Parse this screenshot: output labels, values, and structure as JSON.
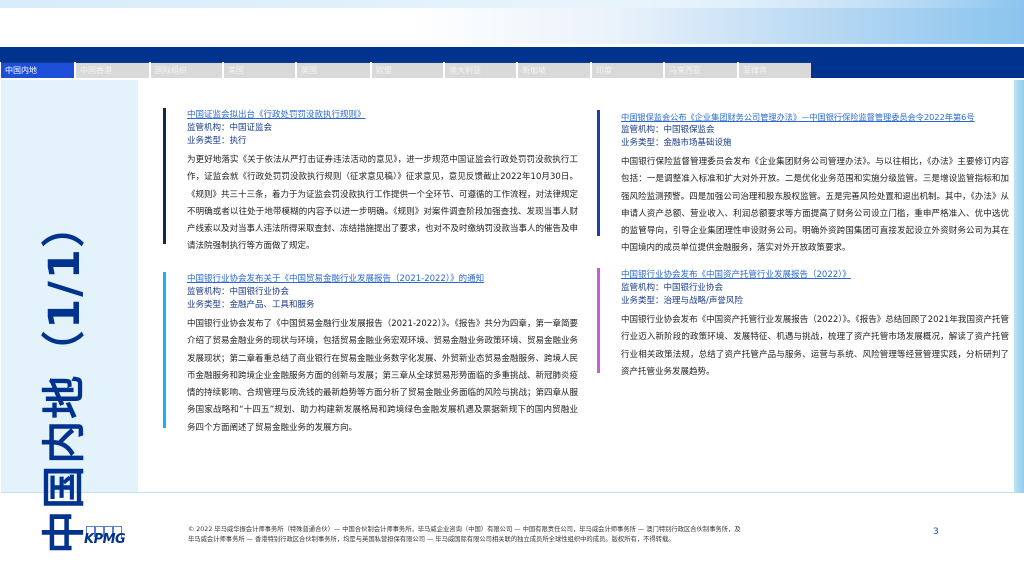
{
  "tabs": [
    {
      "label": "中国内地",
      "active": true
    },
    {
      "label": "中国香港"
    },
    {
      "label": "国际组织"
    },
    {
      "label": "美国"
    },
    {
      "label": "英国"
    },
    {
      "label": "欧盟"
    },
    {
      "label": "澳大利亚"
    },
    {
      "label": "新加坡"
    },
    {
      "label": "印度"
    },
    {
      "label": "马来西亚"
    },
    {
      "label": "菲律宾"
    }
  ],
  "section_title": "中国内地（1/1）",
  "cards": [
    {
      "title": "中国证监会拟出台《行政处罚罚没款执行规则》",
      "regulator": "监管机构：中国证监会",
      "type": "业务类型：执行",
      "body": "为更好地落实《关于依法从严打击证券违法活动的意见》，进一步规范中国证监会行政处罚罚没款执行工作，证监会就《行政处罚罚没款执行规则（征求意见稿）》征求意见，意见反馈截止2022年10月30日。《规则》共三十三条，着力于为证监会罚没款执行工作提供一个全环节、可遵循的工作流程，对法律规定不明确或者以往处于地带模糊的内容予以进一步明确。《规则》对案件调查阶段加强查找、发现当事人财产线索以及对当事人违法所得采取查封、冻结措施提出了要求，也对不及时缴纳罚没款当事人的催告及申请法院强制执行等方面做了规定。",
      "color": "#14284b"
    },
    {
      "title": "中国银行业协会发布关于《中国贸易金融行业发展报告（2021-2022）》的通知",
      "regulator": "监管机构：中国银行业协会",
      "type": "业务类型：金融产品、工具和服务",
      "body": "中国银行业协会发布了《中国贸易金融行业发展报告（2021-2022）》。《报告》共分为四章，第一章简要介绍了贸易金融业务的现状与环境，包括贸易金融业务宏观环境、贸易金融业务政策环境、贸易金融业务发展现状；第二章着重总结了商业银行在贸易金融业务数字化发展、外贸新业态贸易金融服务、跨境人民币金融服务和跨境企业金融服务方面的创新与发展；第三章从全球贸易形势面临的多重挑战、新冠肺炎疫情的持续影响、合规管理与反洗钱的最新趋势等方面分析了贸易金融业务面临的风险与挑战；第四章从服务国家战略和“十四五”规划、助力构建新发展格局和跨境绿色金融发展机遇及票据新规下的国内贸融业务四个方面阐述了贸易金融业务的发展方向。",
      "color": "#19b2ea"
    },
    {
      "title": "中国银保监会公布《企业集团财务公司管理办法》—中国银行保险监督管理委员会令2022年第6号",
      "regulator": "监管机构：中国银保监会",
      "type": "业务类型：金融市场基础设施",
      "body": "中国银行保险监督管理委员会发布《企业集团财务公司管理办法》。与以往相比，《办法》主要修订内容包括：一是调整准入标准和扩大对外开放。二是优化业务范围和实施分级监管。三是增设监管指标和加强风险监测预警。四是加强公司治理和股东股权监管。五是完善风险处置和退出机制。其中，《办法》从申请人资产总额、营业收入、利润总额要求等方面提高了财务公司设立门槛，重申严格准入、优中选优的监管导向，引导企业集团理性申设财务公司。明确外资跨国集团可直接发起设立外资财务公司为其在中国境内的成员单位提供金融服务，落实对外开放政策要求。",
      "color": "#1e3fa6"
    },
    {
      "title": "中国银行业协会发布《中国资产托管行业发展报告（2022）》",
      "regulator": "监管机构：中国银行业协会",
      "type": "业务类型：治理与战略/声誉风险",
      "body": "中国银行业协会发布《中国资产托管行业发展报告（2022）》。《报告》总结回顾了2021年我国资产托管行业迈入新阶段的政策环境、发展特征、机遇与挑战，梳理了资产托管市场发展概况，解读了资产托管行业相关政策法规，总结了资产托管产品与服务、运营与系统、风险管理等经营管理实践，分析研判了资产托管业务发展趋势。",
      "color": "#c25fd1"
    }
  ],
  "footer": {
    "logo": "KPMG",
    "line1": "© 2022 毕马威华振会计师事务所（特殊普通合伙）— 中国合伙制会计师事务所，毕马威企业咨询（中国）有限公司 — 中国有限责任公司，毕马威会计师事务所 — 澳门特别行政区合伙制事务所，及",
    "line2": "毕马威会计师事务所 — 香港特别行政区合伙制事务所，均是与英国私营担保有限公司 — 毕马威国际有限公司相关联的独立成员所全球性组织中的成员。版权所有，不得转载。",
    "page": "3"
  }
}
